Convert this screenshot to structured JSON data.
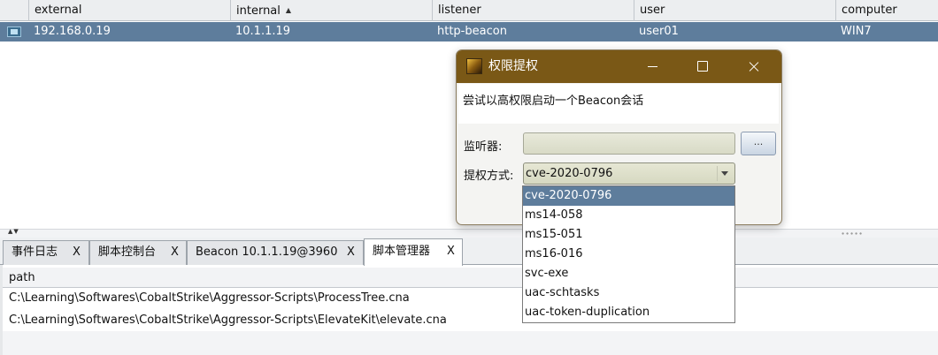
{
  "beacon_table": {
    "columns": [
      "external",
      "internal",
      "listener",
      "user",
      "computer"
    ],
    "sorted_column_indicator": "sort-ascending-icon",
    "rows": [
      {
        "icon": "beacon-session-icon",
        "external": "192.168.0.19",
        "internal": "10.1.1.19",
        "listener": "http-beacon",
        "user": "user01",
        "computer": "WIN7"
      }
    ]
  },
  "tabs": [
    {
      "label": "事件日志",
      "close": "X"
    },
    {
      "label": "脚本控制台",
      "close": "X"
    },
    {
      "label": "Beacon 10.1.1.19@3960",
      "close": "X"
    },
    {
      "label": "脚本管理器",
      "close": "X",
      "active": true
    }
  ],
  "scripts_table": {
    "column": "path",
    "rows": [
      "C:\\Learning\\Softwares\\CobaltStrike\\Aggressor-Scripts\\ProcessTree.cna",
      "C:\\Learning\\Softwares\\CobaltStrike\\Aggressor-Scripts\\ElevateKit\\elevate.cna"
    ]
  },
  "dialog": {
    "title": "权限提权",
    "description": "尝试以高权限启动一个Beacon会话",
    "listener_label": "监听器:",
    "listener_value": "",
    "browse_label": "...",
    "exploit_label": "提权方式:",
    "exploit_value": "cve-2020-0796",
    "exploit_options": [
      "cve-2020-0796",
      "ms14-058",
      "ms15-051",
      "ms16-016",
      "svc-exe",
      "uac-schtasks",
      "uac-token-duplication"
    ],
    "selected_option_index": 0
  },
  "colors": {
    "selection": "#5e7d9c",
    "dialog_titlebar": "#7a5816"
  }
}
